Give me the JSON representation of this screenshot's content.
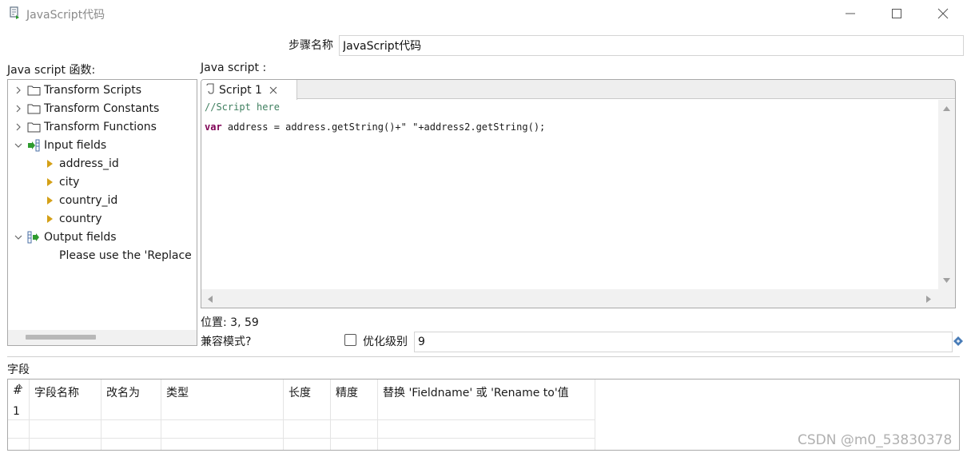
{
  "window": {
    "title": "JavaScript代码",
    "icons": {
      "app": "script-app-icon",
      "minimize": "minimize-icon",
      "maximize": "maximize-icon",
      "close": "close-icon"
    }
  },
  "step": {
    "label": "步骤名称",
    "value": "JavaScript代码"
  },
  "functions_panel": {
    "label": "Java script 函数:",
    "tree": [
      {
        "label": "Transform Scripts",
        "icon": "folder-icon",
        "expanded": false
      },
      {
        "label": "Transform Constants",
        "icon": "folder-icon",
        "expanded": false
      },
      {
        "label": "Transform Functions",
        "icon": "folder-icon",
        "expanded": false
      },
      {
        "label": "Input fields",
        "icon": "input-fields-icon",
        "expanded": true,
        "children": [
          "address_id",
          "city",
          "country_id",
          "country"
        ]
      },
      {
        "label": "Output fields",
        "icon": "output-fields-icon",
        "expanded": true,
        "children": [
          "Please use the 'Replace"
        ]
      }
    ]
  },
  "script_panel": {
    "label": "Java script :",
    "tab": {
      "label": "Script 1",
      "icon": "script-tab-icon"
    },
    "code": {
      "comment": "//Script here",
      "keyword": "var",
      "statement": " address = address.getString()+\" \"+address2.getString();"
    }
  },
  "status": {
    "position": "位置: 3, 59"
  },
  "compat": {
    "label": "兼容模式?"
  },
  "optimization": {
    "label": "优化级别",
    "value": "9",
    "checked": false
  },
  "fields": {
    "label": "字段",
    "columns": [
      "#",
      "字段名称",
      "改名为",
      "类型",
      "长度",
      "精度",
      "替换 'Fieldname' 或 'Rename to'值"
    ],
    "rows": [
      {
        "num": "1"
      }
    ]
  },
  "watermark": "CSDN @m0_53830378",
  "colors": {
    "keyword": "#7f0055",
    "comment": "#3f7f5f",
    "input_arrow": "#d4a017",
    "green": "#2e9b2e"
  }
}
